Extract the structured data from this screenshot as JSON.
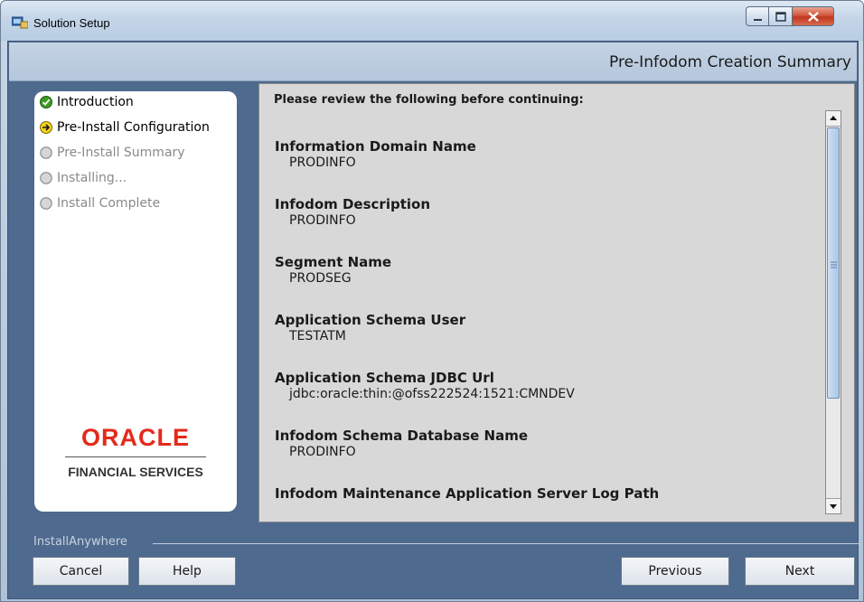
{
  "window": {
    "title": "Solution Setup"
  },
  "header": {
    "title": "Pre-Infodom Creation Summary"
  },
  "steps": [
    {
      "label": "Introduction",
      "state": "done"
    },
    {
      "label": "Pre-Install Configuration",
      "state": "active"
    },
    {
      "label": "Pre-Install Summary",
      "state": "pending"
    },
    {
      "label": "Installing...",
      "state": "pending"
    },
    {
      "label": "Install Complete",
      "state": "pending"
    }
  ],
  "branding": {
    "oracle": "ORACLE",
    "subtitle": "FINANCIAL SERVICES",
    "colors": {
      "brand_red": "#e32a1a"
    }
  },
  "review": {
    "heading": "Please review the following before continuing:",
    "items": [
      {
        "label": "Information Domain Name",
        "value": "PRODINFO"
      },
      {
        "label": "Infodom Description",
        "value": "PRODINFO"
      },
      {
        "label": "Segment Name",
        "value": "PRODSEG"
      },
      {
        "label": "Application Schema User",
        "value": "TESTATM"
      },
      {
        "label": "Application Schema JDBC Url",
        "value": "jdbc:oracle:thin:@ofss222524:1521:CMNDEV"
      },
      {
        "label": "Infodom Schema Database Name",
        "value": "PRODINFO"
      },
      {
        "label": "Infodom Maintenance Application Server Log Path",
        "value": ""
      }
    ]
  },
  "footer": {
    "installer_label": "InstallAnywhere",
    "cancel_label": "Cancel",
    "help_label": "Help",
    "previous_label": "Previous",
    "next_label": "Next"
  }
}
